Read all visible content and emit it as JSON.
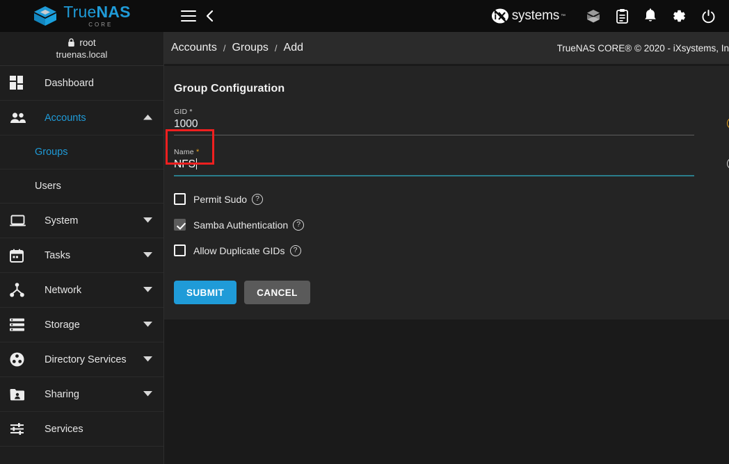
{
  "topbar": {
    "brand_name_light": "True",
    "brand_name_bold": "NAS",
    "brand_sub": "CORE",
    "menu_icon": "hamburger-menu-icon",
    "back_icon": "chevron-left-icon",
    "vendor_word": "systems",
    "vendor_tm": "™",
    "icons": [
      {
        "name": "jails-cube-icon",
        "glyph": "cube"
      },
      {
        "name": "task-manager-clipboard-icon",
        "glyph": "clipboard"
      },
      {
        "name": "notifications-bell-icon",
        "glyph": "bell"
      },
      {
        "name": "settings-gear-icon",
        "glyph": "gear"
      },
      {
        "name": "power-icon",
        "glyph": "power"
      }
    ]
  },
  "sidebar": {
    "user": "root",
    "host": "truenas.local",
    "lock_icon": "lock-icon",
    "items": [
      {
        "label": "Dashboard",
        "icon": "dashboard-grid-icon",
        "expandable": false,
        "active": false
      },
      {
        "label": "Accounts",
        "icon": "accounts-people-icon",
        "expandable": true,
        "expanded": true,
        "active": true
      },
      {
        "label": "System",
        "icon": "system-laptop-icon",
        "expandable": true,
        "expanded": false,
        "active": false
      },
      {
        "label": "Tasks",
        "icon": "tasks-calendar-icon",
        "expandable": true,
        "expanded": false,
        "active": false
      },
      {
        "label": "Network",
        "icon": "network-share-icon",
        "expandable": true,
        "expanded": false,
        "active": false
      },
      {
        "label": "Storage",
        "icon": "storage-database-icon",
        "expandable": true,
        "expanded": false,
        "active": false
      },
      {
        "label": "Directory Services",
        "icon": "directory-services-icon",
        "expandable": true,
        "expanded": false,
        "active": false
      },
      {
        "label": "Sharing",
        "icon": "sharing-folder-icon",
        "expandable": true,
        "expanded": false,
        "active": false
      },
      {
        "label": "Services",
        "icon": "services-sliders-icon",
        "expandable": false,
        "active": false
      }
    ],
    "subitems": [
      {
        "label": "Groups",
        "active": true
      },
      {
        "label": "Users",
        "active": false
      }
    ]
  },
  "breadcrumb": {
    "items": [
      "Accounts",
      "Groups",
      "Add"
    ],
    "separator": "/",
    "copyright": "TrueNAS CORE® © 2020 - iXsystems, In"
  },
  "form": {
    "title": "Group Configuration",
    "gid": {
      "label": "GID",
      "required_mark": "*",
      "value": "1000",
      "help_icon": "help-circle-icon"
    },
    "name": {
      "label": "Name",
      "required_mark": "*",
      "value": "NFS",
      "placeholder": "",
      "help_icon": "help-circle-icon",
      "focused": true
    },
    "checkboxes": [
      {
        "label": "Permit Sudo",
        "checked": false,
        "help_icon": "help-circle-icon"
      },
      {
        "label": "Samba Authentication",
        "checked": true,
        "help_icon": "help-circle-icon"
      },
      {
        "label": "Allow Duplicate GIDs",
        "checked": false,
        "help_icon": "help-circle-icon"
      }
    ],
    "submit_label": "SUBMIT",
    "cancel_label": "CANCEL"
  },
  "colors": {
    "accent_blue": "#1f9bd8",
    "required_orange": "#e8a21c",
    "focus_underline": "#2a7e8c",
    "highlight_red": "#f01f1f",
    "cancel_gray": "#5a5a5a",
    "sidebar_bg": "#1e1e1e",
    "card_bg": "#242424"
  },
  "annotation": {
    "highlight_target": "name-field"
  }
}
